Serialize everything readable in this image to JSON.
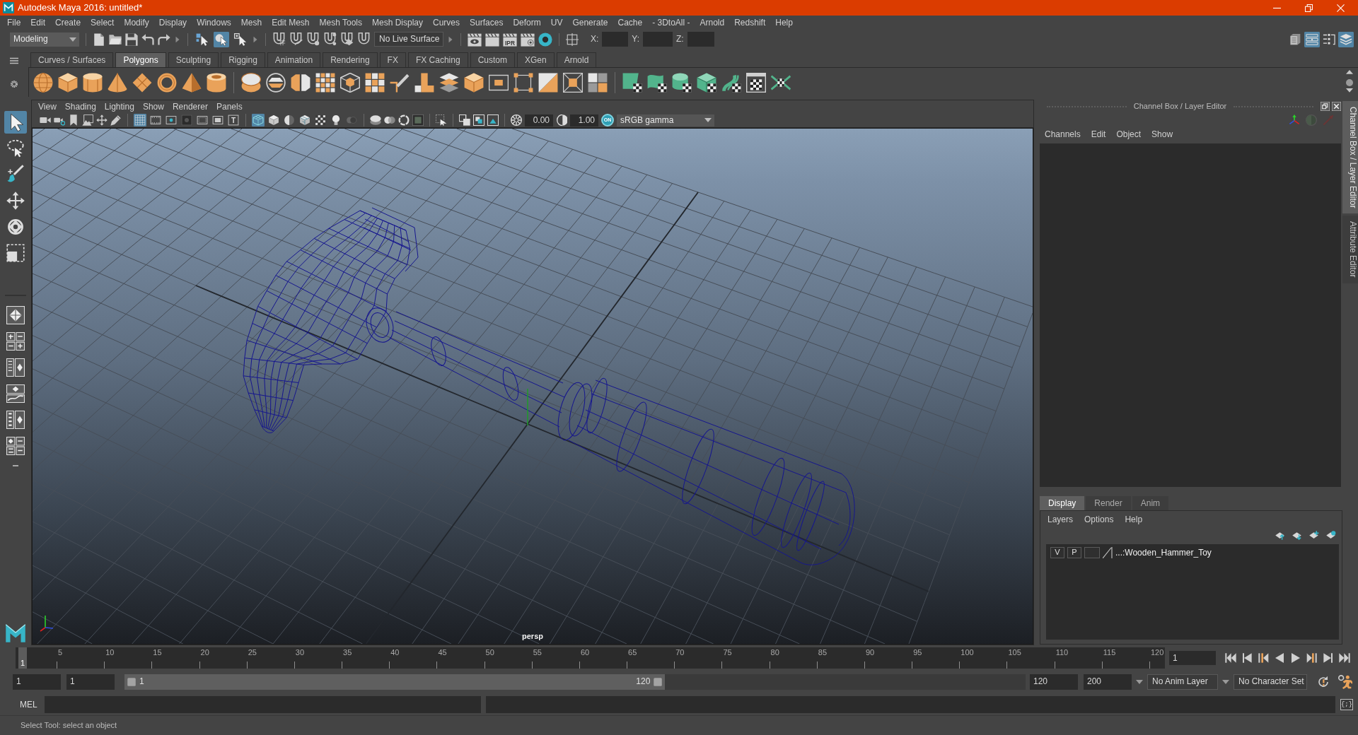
{
  "window": {
    "title": "Autodesk Maya 2016: untitled*"
  },
  "menu_bar": [
    "File",
    "Edit",
    "Create",
    "Select",
    "Modify",
    "Display",
    "Windows",
    "Mesh",
    "Edit Mesh",
    "Mesh Tools",
    "Mesh Display",
    "Curves",
    "Surfaces",
    "Deform",
    "UV",
    "Generate",
    "Cache",
    "- 3DtoAll -",
    "Arnold",
    "Redshift",
    "Help"
  ],
  "status_line": {
    "menu_set": "Modeling",
    "selection_modes": [
      {
        "selected": false
      },
      {
        "selected": true
      },
      {
        "selected": false
      }
    ],
    "live_surface": "No Live Surface",
    "ipr_label": "IPR",
    "transform_fields": [
      {
        "label": "X:"
      },
      {
        "label": "Y:"
      },
      {
        "label": "Z:"
      }
    ],
    "panel_toggles": [
      {
        "on": false
      },
      {
        "on": true
      },
      {
        "on": false
      },
      {
        "on": true
      }
    ]
  },
  "shelf": {
    "tabs": [
      {
        "label": "Curves / Surfaces",
        "selected": false
      },
      {
        "label": "Polygons",
        "selected": true
      },
      {
        "label": "Sculpting",
        "selected": false
      },
      {
        "label": "Rigging",
        "selected": false
      },
      {
        "label": "Animation",
        "selected": false
      },
      {
        "label": "Rendering",
        "selected": false
      },
      {
        "label": "FX",
        "selected": false
      },
      {
        "label": "FX Caching",
        "selected": false
      },
      {
        "label": "Custom",
        "selected": false
      },
      {
        "label": "XGen",
        "selected": false
      },
      {
        "label": "Arnold",
        "selected": false
      }
    ]
  },
  "toolbox": {
    "tools": [
      {
        "selected": true
      },
      {
        "selected": false
      },
      {
        "selected": false
      },
      {
        "selected": false
      },
      {
        "selected": false
      },
      {
        "selected": false
      }
    ]
  },
  "viewport": {
    "menu": [
      "View",
      "Shading",
      "Lighting",
      "Show",
      "Renderer",
      "Panels"
    ],
    "display_toggles": [
      {
        "on": true
      },
      {
        "on": false
      },
      {
        "on": false
      },
      {
        "on": false
      },
      {
        "on": false
      },
      {
        "on": false
      },
      {
        "on": false
      }
    ],
    "title_safe_label": "T",
    "shading_toggles": [
      {
        "on": true
      },
      {
        "on": false
      },
      {
        "on": false
      },
      {
        "on": false
      },
      {
        "on": false
      },
      {
        "on": false
      },
      {
        "on": false
      }
    ],
    "near_clip": "0.00",
    "far_clip": "1.00",
    "gamma_toggle": {
      "label": "ON",
      "on": true
    },
    "color_space": "sRGB gamma",
    "camera": "persp"
  },
  "channel_box": {
    "title": "Channel Box / Layer Editor",
    "menu": [
      "Channels",
      "Edit",
      "Object",
      "Show"
    ]
  },
  "layer_editor": {
    "tabs": [
      {
        "label": "Display",
        "selected": true
      },
      {
        "label": "Render",
        "selected": false
      },
      {
        "label": "Anim",
        "selected": false
      }
    ],
    "menu": [
      "Layers",
      "Options",
      "Help"
    ],
    "layers": [
      {
        "visibility": "V",
        "playback": "P",
        "name": "...:Wooden_Hammer_Toy"
      }
    ]
  },
  "side_tabs": [
    {
      "label": "Channel Box / Layer Editor",
      "selected": true
    },
    {
      "label": "Attribute Editor",
      "selected": false
    }
  ],
  "time_slider": {
    "current_frame": "1",
    "level": 0,
    "ticks": [
      "5",
      "10",
      "15",
      "20",
      "25",
      "30",
      "35",
      "40",
      "45",
      "50",
      "55",
      "60",
      "65",
      "70",
      "75",
      "80",
      "85",
      "90",
      "95",
      "100",
      "105",
      "110",
      "115",
      "120"
    ],
    "frame_field": "1"
  },
  "range_slider": {
    "start": "1",
    "playback_start": "1",
    "range_start": "1",
    "range_end": "120",
    "level": 0.6,
    "playback_end": "120",
    "end": "200",
    "anim_layer": "No Anim Layer",
    "character_set": "No Character Set"
  },
  "command_line": {
    "label": "MEL",
    "script_editor_glyph": "{;}"
  },
  "help_line": "Select Tool: select an object"
}
